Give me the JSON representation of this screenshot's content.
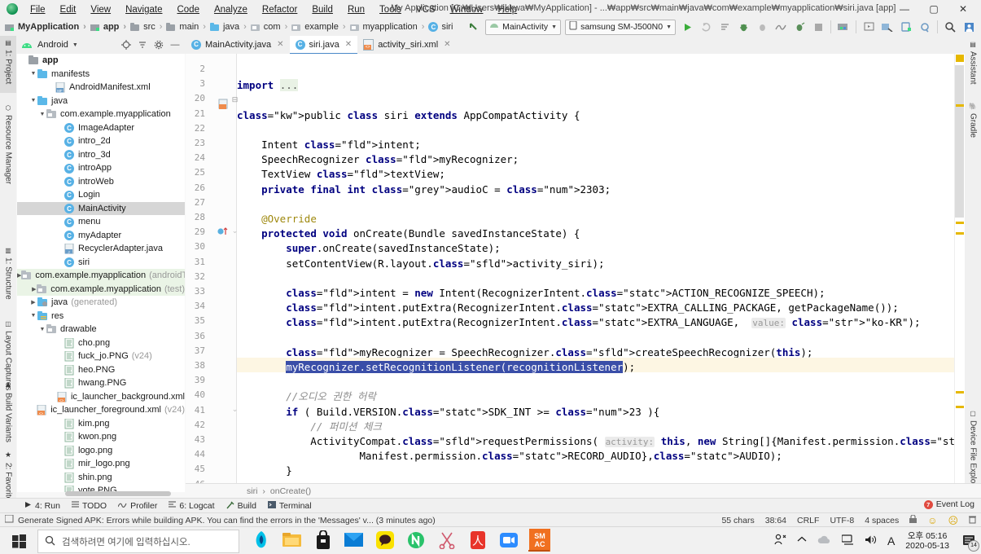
{
  "window": {
    "title": "My Application [C:₩Users₩jkkwa₩MyApplication] - ...₩app₩src₩main₩java₩com₩example₩myapplication₩siri.java [app] - Android Studio",
    "minimize": "—",
    "maximize": "▢",
    "close": "✕",
    "logo_icon": "android-studio-logo"
  },
  "menu": [
    {
      "label": "File"
    },
    {
      "label": "Edit"
    },
    {
      "label": "View"
    },
    {
      "label": "Navigate"
    },
    {
      "label": "Code"
    },
    {
      "label": "Analyze"
    },
    {
      "label": "Refactor"
    },
    {
      "label": "Build"
    },
    {
      "label": "Run"
    },
    {
      "label": "Tools"
    },
    {
      "label": "VCS"
    },
    {
      "label": "Window"
    },
    {
      "label": "Help"
    }
  ],
  "breadcrumb": [
    {
      "label": "MyApplication",
      "icon": "module-icon",
      "bold": true
    },
    {
      "label": "app",
      "icon": "module-icon",
      "bold": true
    },
    {
      "label": "src",
      "icon": "folder-icon",
      "bold": false
    },
    {
      "label": "main",
      "icon": "folder-icon",
      "bold": false
    },
    {
      "label": "java",
      "icon": "folder-blue-icon",
      "bold": false
    },
    {
      "label": "com",
      "icon": "package-icon",
      "bold": false
    },
    {
      "label": "example",
      "icon": "package-icon",
      "bold": false
    },
    {
      "label": "myapplication",
      "icon": "package-icon",
      "bold": false
    },
    {
      "label": "siri",
      "icon": "class-icon",
      "bold": false
    }
  ],
  "toolbar": {
    "back_icon": "arrow-back-icon",
    "run_config": "MainActivity",
    "device": "samsung SM-J500N0",
    "icons": [
      "run-icon",
      "apply-changes-icon",
      "apply-code-changes-icon",
      "debug-icon",
      "attach-debugger-icon",
      "profiler-icon",
      "run-coverage-icon",
      "stop-icon",
      "sdk-manager-icon",
      "avd-manager-icon",
      "layout-inspector-icon",
      "device-manager-icon",
      "sync-gradle-icon",
      "search-icon",
      "avatar-icon"
    ]
  },
  "left_tool_tabs": [
    {
      "label": "1: Project",
      "icon": "project-icon",
      "selected": true
    },
    {
      "label": "Resource Manager",
      "icon": "resource-icon",
      "selected": false
    },
    {
      "label": "1: Structure",
      "icon": "structure-icon",
      "selected": false
    },
    {
      "label": "Layout Captures",
      "icon": "layout-captures-icon",
      "selected": false
    },
    {
      "label": "Build Variants",
      "icon": "build-variants-icon",
      "selected": false
    },
    {
      "label": "2: Favorites",
      "icon": "star-icon",
      "selected": false
    }
  ],
  "right_tool_tabs": [
    {
      "label": "Assistant",
      "icon": "assistant-icon"
    },
    {
      "label": "Gradle",
      "icon": "gradle-icon"
    },
    {
      "label": "Device File Explorer",
      "icon": "device-file-explorer-icon"
    }
  ],
  "project_panel": {
    "view_selector": "Android",
    "view_icon": "android-icon",
    "chevron": "▾",
    "header_icons": [
      "locate-icon",
      "collapse-all-icon",
      "settings-icon",
      "hide-icon"
    ],
    "tree": [
      {
        "indent": 0,
        "twisty": "",
        "icon": "folder-icon",
        "label": "app",
        "sub": "",
        "state": "bold"
      },
      {
        "indent": 1,
        "twisty": "▼",
        "icon": "folder-blue-icon",
        "label": "manifests",
        "sub": "",
        "state": ""
      },
      {
        "indent": 3,
        "twisty": "",
        "icon": "manifest-icon",
        "label": "AndroidManifest.xml",
        "sub": "",
        "state": ""
      },
      {
        "indent": 1,
        "twisty": "▼",
        "icon": "folder-blue-icon",
        "label": "java",
        "sub": "",
        "state": ""
      },
      {
        "indent": 2,
        "twisty": "▼",
        "icon": "package-icon",
        "label": "com.example.myapplication",
        "sub": "",
        "state": ""
      },
      {
        "indent": 4,
        "twisty": "",
        "icon": "class-icon",
        "label": "ImageAdapter",
        "sub": "",
        "state": ""
      },
      {
        "indent": 4,
        "twisty": "",
        "icon": "class-icon",
        "label": "intro_2d",
        "sub": "",
        "state": ""
      },
      {
        "indent": 4,
        "twisty": "",
        "icon": "class-icon",
        "label": "intro_3d",
        "sub": "",
        "state": ""
      },
      {
        "indent": 4,
        "twisty": "",
        "icon": "class-icon",
        "label": "introApp",
        "sub": "",
        "state": ""
      },
      {
        "indent": 4,
        "twisty": "",
        "icon": "class-icon",
        "label": "introWeb",
        "sub": "",
        "state": ""
      },
      {
        "indent": 4,
        "twisty": "",
        "icon": "class-icon",
        "label": "Login",
        "sub": "",
        "state": ""
      },
      {
        "indent": 4,
        "twisty": "",
        "icon": "class-icon",
        "label": "MainActivity",
        "sub": "",
        "state": "selected"
      },
      {
        "indent": 4,
        "twisty": "",
        "icon": "class-icon",
        "label": "menu",
        "sub": "",
        "state": ""
      },
      {
        "indent": 4,
        "twisty": "",
        "icon": "class-icon",
        "label": "myAdapter",
        "sub": "",
        "state": ""
      },
      {
        "indent": 4,
        "twisty": "",
        "icon": "java-file-icon",
        "label": "RecyclerAdapter.java",
        "sub": "",
        "state": ""
      },
      {
        "indent": 4,
        "twisty": "",
        "icon": "class-icon",
        "label": "siri",
        "sub": "",
        "state": ""
      },
      {
        "indent": 2,
        "twisty": "▶",
        "icon": "package-icon",
        "label": "com.example.myapplication",
        "sub": "(androidTe",
        "state": "highlight"
      },
      {
        "indent": 2,
        "twisty": "▶",
        "icon": "package-icon",
        "label": "com.example.myapplication",
        "sub": "(test)",
        "state": "highlight"
      },
      {
        "indent": 1,
        "twisty": "▶",
        "icon": "folder-gen-icon",
        "label": "java",
        "sub": "(generated)",
        "state": ""
      },
      {
        "indent": 1,
        "twisty": "▼",
        "icon": "res-folder-icon",
        "label": "res",
        "sub": "",
        "state": ""
      },
      {
        "indent": 2,
        "twisty": "▼",
        "icon": "package-icon",
        "label": "drawable",
        "sub": "",
        "state": ""
      },
      {
        "indent": 4,
        "twisty": "",
        "icon": "png-file-icon",
        "label": "cho.png",
        "sub": "",
        "state": ""
      },
      {
        "indent": 4,
        "twisty": "",
        "icon": "png-file-icon",
        "label": "fuck_jo.PNG",
        "sub": "(v24)",
        "state": ""
      },
      {
        "indent": 4,
        "twisty": "",
        "icon": "png-file-icon",
        "label": "heo.PNG",
        "sub": "",
        "state": ""
      },
      {
        "indent": 4,
        "twisty": "",
        "icon": "png-file-icon",
        "label": "hwang.PNG",
        "sub": "",
        "state": ""
      },
      {
        "indent": 4,
        "twisty": "",
        "icon": "xml-file-icon",
        "label": "ic_launcher_background.xml",
        "sub": "",
        "state": ""
      },
      {
        "indent": 4,
        "twisty": "",
        "icon": "xml-file-icon",
        "label": "ic_launcher_foreground.xml",
        "sub": "(v24)",
        "state": ""
      },
      {
        "indent": 4,
        "twisty": "",
        "icon": "png-file-icon",
        "label": "kim.png",
        "sub": "",
        "state": ""
      },
      {
        "indent": 4,
        "twisty": "",
        "icon": "png-file-icon",
        "label": "kwon.png",
        "sub": "",
        "state": ""
      },
      {
        "indent": 4,
        "twisty": "",
        "icon": "png-file-icon",
        "label": "logo.png",
        "sub": "",
        "state": ""
      },
      {
        "indent": 4,
        "twisty": "",
        "icon": "png-file-icon",
        "label": "mir_logo.png",
        "sub": "",
        "state": ""
      },
      {
        "indent": 4,
        "twisty": "",
        "icon": "png-file-icon",
        "label": "shin.png",
        "sub": "",
        "state": ""
      },
      {
        "indent": 4,
        "twisty": "",
        "icon": "png-file-icon",
        "label": "vote.PNG",
        "sub": "",
        "state": ""
      }
    ]
  },
  "editor_tabs": [
    {
      "label": "MainActivity.java",
      "icon": "class-icon",
      "active": false,
      "close": "✕"
    },
    {
      "label": "siri.java",
      "icon": "class-icon",
      "active": true,
      "close": "✕"
    },
    {
      "label": "activity_siri.xml",
      "icon": "xml-file-icon",
      "active": false,
      "close": "✕"
    }
  ],
  "code": {
    "line_numbers": [
      "2",
      "3",
      "20",
      "21",
      "22",
      "23",
      "24",
      "25",
      "26",
      "27",
      "28",
      "29",
      "30",
      "31",
      "32",
      "33",
      "34",
      "35",
      "36",
      "37",
      "38",
      "39",
      "40",
      "41",
      "42",
      "43",
      "44",
      "45",
      "46"
    ],
    "lines": [
      "",
      "import ...",
      "",
      "public class siri extends AppCompatActivity {",
      "",
      "    Intent intent;",
      "    SpeechRecognizer myRecognizer;",
      "    TextView textView;",
      "    private final int audioC = 2303;",
      "",
      "    @Override",
      "    protected void onCreate(Bundle savedInstanceState) {",
      "        super.onCreate(savedInstanceState);",
      "        setContentView(R.layout.activity_siri);",
      "",
      "        intent = new Intent(RecognizerIntent.ACTION_RECOGNIZE_SPEECH);",
      "        intent.putExtra(RecognizerIntent.EXTRA_CALLING_PACKAGE, getPackageName());",
      "        intent.putExtra(RecognizerIntent.EXTRA_LANGUAGE,  value: \"ko-KR\");",
      "",
      "        myRecognizer = SpeechRecognizer.createSpeechRecognizer(this);",
      "        myRecognizer.setRecognitionListener(recognitionListener);",
      "",
      "        //오디오 권한 허락",
      "        if ( Build.VERSION.SDK_INT >= 23 ){",
      "            // 퍼미션 체크",
      "            ActivityCompat.requestPermissions( activity: this, new String[]{Manifest.permission.INTERNET,",
      "                    Manifest.permission.RECORD_AUDIO},AUDIO);",
      "        }",
      "",
      ""
    ],
    "selection": "myRecognizer.setRecognitionListener(recognitionListener",
    "breadcrumb": [
      "siri",
      "onCreate()"
    ],
    "breadcrumb_sep": "›"
  },
  "bottom_tabs": [
    {
      "label": "4: Run",
      "icon": "run-icon"
    },
    {
      "label": "TODO",
      "icon": "todo-icon"
    },
    {
      "label": "Profiler",
      "icon": "profiler-icon"
    },
    {
      "label": "6: Logcat",
      "icon": "logcat-icon"
    },
    {
      "label": "Build",
      "icon": "build-icon"
    },
    {
      "label": "Terminal",
      "icon": "terminal-icon"
    }
  ],
  "event_log": {
    "label": "Event Log",
    "count": "7"
  },
  "status_bar": {
    "message": "Generate Signed APK: Errors while building APK. You can find the errors in the 'Messages' v... (3 minutes ago)",
    "message_icon": "message-icon",
    "chars": "55 chars",
    "caret": "38:64",
    "line_sep": "CRLF",
    "encoding": "UTF-8",
    "indent": "4 spaces",
    "lock_icon": "lock-icon",
    "face_icons": [
      "smiley-icon",
      "frowny-icon"
    ],
    "trash_icon": "trash-icon"
  },
  "taskbar": {
    "start_icon": "windows-start-icon",
    "search_placeholder": "검색하려면 여기에 입력하십시오.",
    "search_icon": "search-icon",
    "apps": [
      {
        "name": "whale-browser-icon",
        "label": "W"
      },
      {
        "name": "file-explorer-icon",
        "label": ""
      },
      {
        "name": "microsoft-store-icon",
        "label": ""
      },
      {
        "name": "mail-icon",
        "label": ""
      },
      {
        "name": "kakaotalk-icon",
        "label": ""
      },
      {
        "name": "naver-icon",
        "label": ""
      },
      {
        "name": "snipping-tool-icon",
        "label": ""
      },
      {
        "name": "adobe-acrobat-icon",
        "label": ""
      },
      {
        "name": "zoom-icon",
        "label": ""
      },
      {
        "name": "sm-ac-icon",
        "label": "SM\nAC"
      }
    ],
    "tray_icons": [
      "people-icon",
      "show-hidden-icon",
      "onedrive-icon",
      "network-icon",
      "volume-icon",
      "ime-icon"
    ],
    "time": "오후 05:16",
    "date": "2020-05-13",
    "notification_count": "14",
    "ime_label": "A"
  }
}
